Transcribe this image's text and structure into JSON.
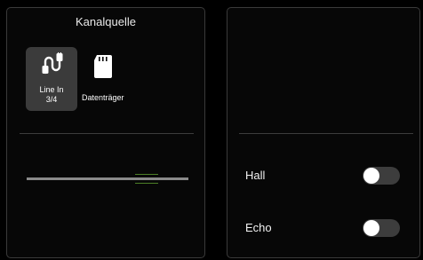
{
  "left_panel": {
    "title": "Kanalquelle",
    "sources": [
      {
        "label_line1": "Line In",
        "label_line2": "3/4",
        "icon": "cable-connector-icon",
        "selected": true
      },
      {
        "label": "Datenträger",
        "icon": "sd-card-icon",
        "selected": false
      }
    ],
    "level_meter": {
      "marker_color": "#4c7f27"
    }
  },
  "right_panel": {
    "toggles": [
      {
        "label": "Hall",
        "on": false
      },
      {
        "label": "Echo",
        "on": false
      }
    ]
  },
  "colors": {
    "background": "#000000",
    "panel": "#070707",
    "selected_tile": "#3b3b3b",
    "toggle_off": "#3d3d3d",
    "meter_accent": "#4c7f27"
  }
}
